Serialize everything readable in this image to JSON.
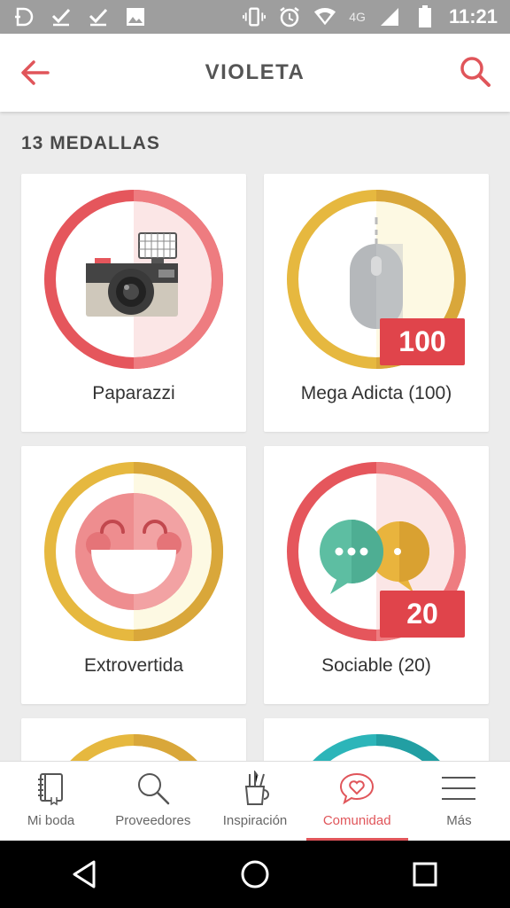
{
  "status_bar": {
    "time": "11:21",
    "network": "4G",
    "icons": [
      "notification-d-icon",
      "check-icon",
      "check-icon",
      "image-icon",
      "vibrate-icon",
      "alarm-icon",
      "wifi-icon",
      "signal-icon",
      "battery-icon"
    ]
  },
  "header": {
    "title": "VIOLETA",
    "back_icon": "arrow-left-icon",
    "search_icon": "search-icon",
    "accent_color": "#e0555a"
  },
  "medals": {
    "count_label": "13 MEDALLAS",
    "items": [
      {
        "label": "Paparazzi",
        "ring": "red",
        "icon": "camera-icon",
        "count": ""
      },
      {
        "label": "Mega Adicta (100)",
        "ring": "gold",
        "icon": "mouse-icon",
        "count": "100"
      },
      {
        "label": "Extrovertida",
        "ring": "gold",
        "icon": "smiley-icon",
        "count": ""
      },
      {
        "label": "Sociable (20)",
        "ring": "red",
        "icon": "chat-bubbles-icon",
        "count": "20"
      }
    ]
  },
  "bottom_nav": {
    "items": [
      {
        "label": "Mi boda",
        "icon": "notebook-icon",
        "active": false
      },
      {
        "label": "Proveedores",
        "icon": "search-icon",
        "active": false
      },
      {
        "label": "Inspiración",
        "icon": "pencil-cup-icon",
        "active": false
      },
      {
        "label": "Comunidad",
        "icon": "heart-bubble-icon",
        "active": true
      },
      {
        "label": "Más",
        "icon": "menu-icon",
        "active": false
      }
    ]
  },
  "android_nav": [
    "back-triangle-icon",
    "home-circle-icon",
    "recents-square-icon"
  ]
}
